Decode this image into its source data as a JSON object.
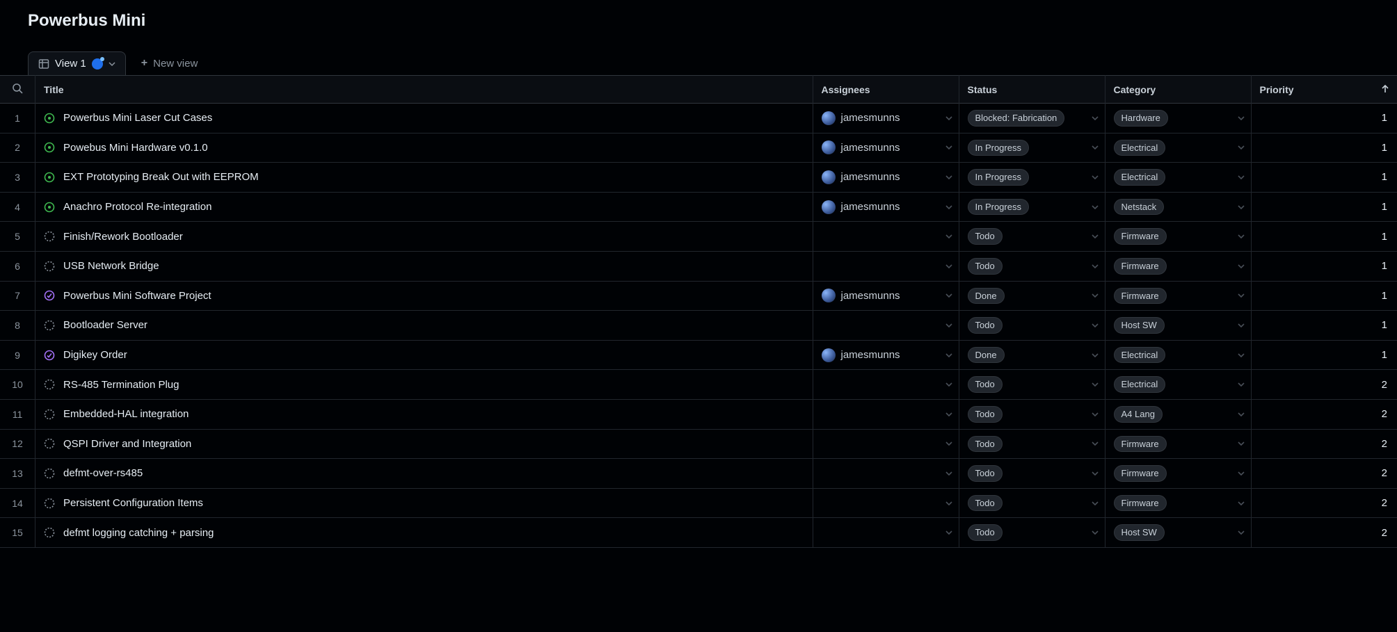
{
  "project_title": "Powerbus Mini",
  "tabs": {
    "active": {
      "label": "View 1",
      "has_indicator": true
    },
    "new_view_label": "New view"
  },
  "columns": {
    "title": "Title",
    "assignees": "Assignees",
    "status": "Status",
    "category": "Category",
    "priority": "Priority"
  },
  "rows": [
    {
      "n": "1",
      "icon": "open",
      "title": "Powerbus Mini Laser Cut Cases",
      "assignee": "jamesmunns",
      "status": "Blocked: Fabrication",
      "category": "Hardware",
      "priority": "1"
    },
    {
      "n": "2",
      "icon": "open",
      "title": "Powebus Mini Hardware v0.1.0",
      "assignee": "jamesmunns",
      "status": "In Progress",
      "category": "Electrical",
      "priority": "1"
    },
    {
      "n": "3",
      "icon": "open",
      "title": "EXT Prototyping Break Out with EEPROM",
      "assignee": "jamesmunns",
      "status": "In Progress",
      "category": "Electrical",
      "priority": "1"
    },
    {
      "n": "4",
      "icon": "open",
      "title": "Anachro Protocol Re-integration",
      "assignee": "jamesmunns",
      "status": "In Progress",
      "category": "Netstack",
      "priority": "1"
    },
    {
      "n": "5",
      "icon": "draft",
      "title": "Finish/Rework Bootloader",
      "assignee": "",
      "status": "Todo",
      "category": "Firmware",
      "priority": "1"
    },
    {
      "n": "6",
      "icon": "draft",
      "title": "USB Network Bridge",
      "assignee": "",
      "status": "Todo",
      "category": "Firmware",
      "priority": "1"
    },
    {
      "n": "7",
      "icon": "done",
      "title": "Powerbus Mini Software Project",
      "assignee": "jamesmunns",
      "status": "Done",
      "category": "Firmware",
      "priority": "1"
    },
    {
      "n": "8",
      "icon": "draft",
      "title": "Bootloader Server",
      "assignee": "",
      "status": "Todo",
      "category": "Host SW",
      "priority": "1"
    },
    {
      "n": "9",
      "icon": "done",
      "title": "Digikey Order",
      "assignee": "jamesmunns",
      "status": "Done",
      "category": "Electrical",
      "priority": "1"
    },
    {
      "n": "10",
      "icon": "draft",
      "title": "RS-485 Termination Plug",
      "assignee": "",
      "status": "Todo",
      "category": "Electrical",
      "priority": "2"
    },
    {
      "n": "11",
      "icon": "draft",
      "title": "Embedded-HAL integration",
      "assignee": "",
      "status": "Todo",
      "category": "A4 Lang",
      "priority": "2"
    },
    {
      "n": "12",
      "icon": "draft",
      "title": "QSPI Driver and Integration",
      "assignee": "",
      "status": "Todo",
      "category": "Firmware",
      "priority": "2"
    },
    {
      "n": "13",
      "icon": "draft",
      "title": "defmt-over-rs485",
      "assignee": "",
      "status": "Todo",
      "category": "Firmware",
      "priority": "2"
    },
    {
      "n": "14",
      "icon": "draft",
      "title": "Persistent Configuration Items",
      "assignee": "",
      "status": "Todo",
      "category": "Firmware",
      "priority": "2"
    },
    {
      "n": "15",
      "icon": "draft",
      "title": "defmt logging catching + parsing",
      "assignee": "",
      "status": "Todo",
      "category": "Host SW",
      "priority": "2"
    }
  ]
}
